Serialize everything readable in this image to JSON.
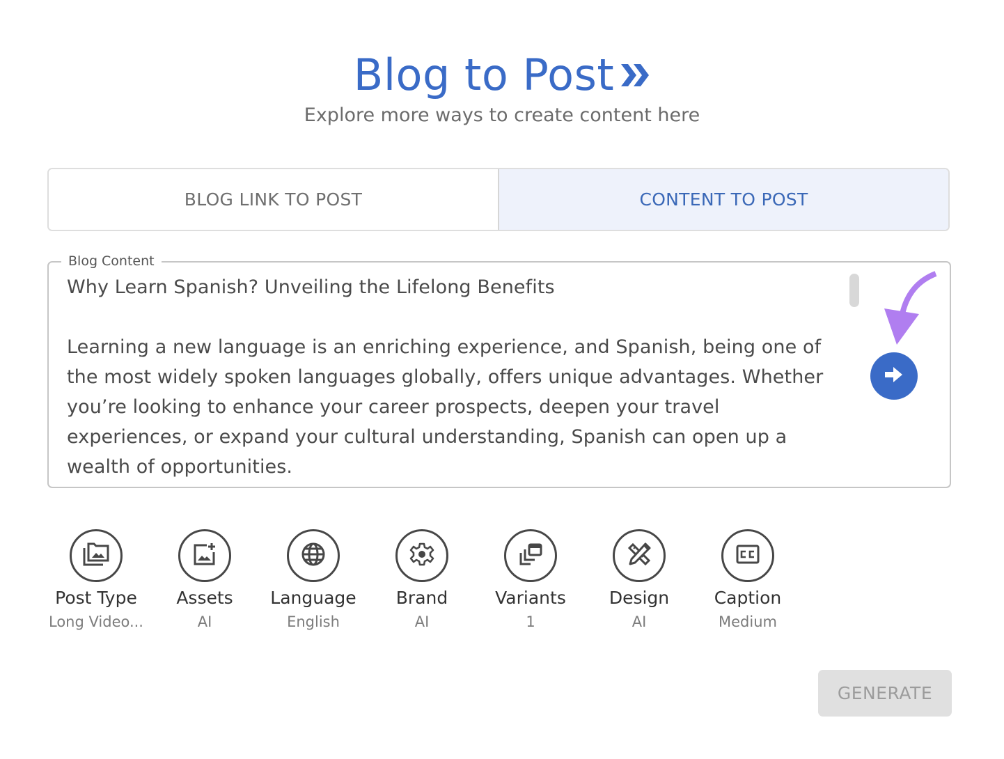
{
  "header": {
    "title": "Blog to Post",
    "title_icon": "double-chevron-right-icon",
    "subtitle": "Explore more ways to create content here"
  },
  "tabs": [
    {
      "label": "BLOG LINK TO POST",
      "active": false
    },
    {
      "label": "CONTENT TO POST",
      "active": true
    }
  ],
  "blog_content": {
    "label": "Blog Content",
    "value": "Why Learn Spanish? Unveiling the Lifelong Benefits\n\nLearning a new language is an enriching experience, and Spanish, being one of the most widely spoken languages globally, offers unique advantages. Whether you’re looking to enhance your career prospects, deepen your travel experiences, or expand your cultural understanding, Spanish can open up a wealth of opportunities.",
    "submit_icon": "arrow-right-icon",
    "annotation_icon": "curved-arrow-down-icon"
  },
  "options": [
    {
      "label": "Post Type",
      "value": "Long Video...",
      "icon": "folder-images-icon"
    },
    {
      "label": "Assets",
      "value": "AI",
      "icon": "add-image-icon"
    },
    {
      "label": "Language",
      "value": "English",
      "icon": "globe-icon"
    },
    {
      "label": "Brand",
      "value": "AI",
      "icon": "gear-icon"
    },
    {
      "label": "Variants",
      "value": "1",
      "icon": "stacked-windows-icon"
    },
    {
      "label": "Design",
      "value": "AI",
      "icon": "pencil-ruler-icon"
    },
    {
      "label": "Caption",
      "value": "Medium",
      "icon": "closed-caption-icon"
    }
  ],
  "actions": {
    "generate_label": "GENERATE",
    "generate_enabled": false
  },
  "colors": {
    "accent": "#3a6bc7",
    "active_tab_bg": "#eef2fb",
    "annotation": "#b07ef0",
    "disabled_bg": "#e0e0e0"
  }
}
